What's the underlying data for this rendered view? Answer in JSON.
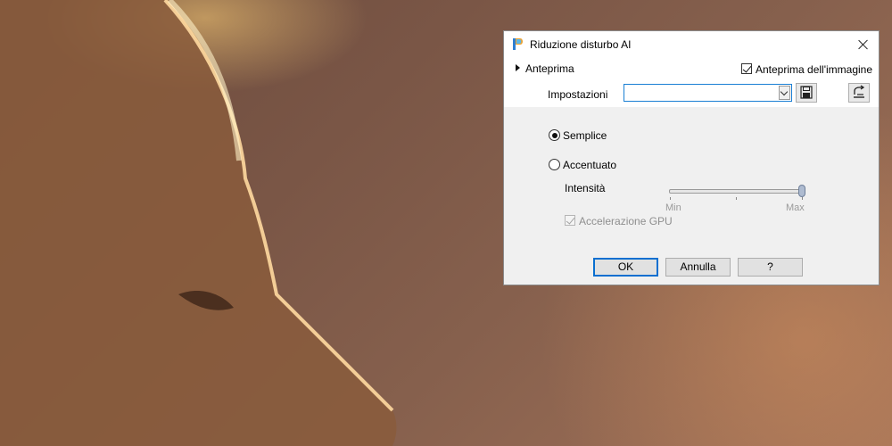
{
  "dialog": {
    "title": "Riduzione disturbo AI",
    "preview_label": "Anteprima",
    "image_preview_label": "Anteprima dell'immagine",
    "image_preview_checked": true,
    "settings_label": "Impostazioni",
    "settings_value": "",
    "mode": {
      "simple_label": "Semplice",
      "enhanced_label": "Accentuato",
      "selected": "Semplice"
    },
    "intensity": {
      "label": "Intensità",
      "min_label": "Min",
      "max_label": "Max",
      "value": 1.0
    },
    "gpu_label": "Accelerazione GPU",
    "gpu_checked": true,
    "gpu_enabled": false,
    "buttons": {
      "ok": "OK",
      "cancel": "Annulla",
      "help": "?"
    }
  },
  "icons": {
    "app": "app-logo-icon",
    "close": "close-icon",
    "expand": "triangle-right-icon",
    "save": "floppy-disk-icon",
    "reset": "reset-preset-icon",
    "combo_arrow": "chevron-down-icon"
  },
  "colors": {
    "accent": "#0a6fd0",
    "panel": "#f0f0f0",
    "disabled_text": "#8f8f8f"
  }
}
